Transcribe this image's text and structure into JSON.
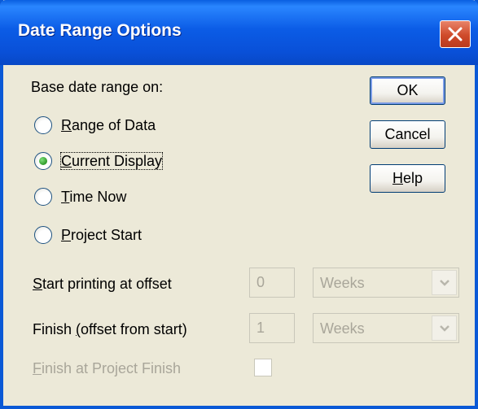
{
  "dialog": {
    "title": "Date Range Options",
    "close_label": "close"
  },
  "base_range": {
    "label": "Base date range on:",
    "options": [
      {
        "key": "R",
        "rest": "ange of Data",
        "selected": false
      },
      {
        "key": "C",
        "rest": "urrent Display",
        "selected": true
      },
      {
        "key": "T",
        "rest": "ime Now",
        "selected": false
      },
      {
        "key": "P",
        "rest": "roject Start",
        "selected": false
      }
    ]
  },
  "buttons": {
    "ok": "OK",
    "cancel": "Cancel",
    "help_key": "H",
    "help_rest": "elp"
  },
  "start_offset": {
    "label_key": "S",
    "label_rest": "tart printing at offset",
    "value": "0",
    "unit": "Weeks"
  },
  "finish_offset": {
    "label_pre": "Finish ",
    "label_key": "(",
    "label_rest": "offset from start)",
    "value": "1",
    "unit": "Weeks"
  },
  "finish_at_project": {
    "label_key": "F",
    "label_rest": "inish at Project Finish",
    "checked": false
  },
  "colors": {
    "title_bar": "#0a59d6",
    "dialog_face": "#ece9d8",
    "disabled_text": "#a9a69a",
    "close_button": "#cf4a2a"
  }
}
